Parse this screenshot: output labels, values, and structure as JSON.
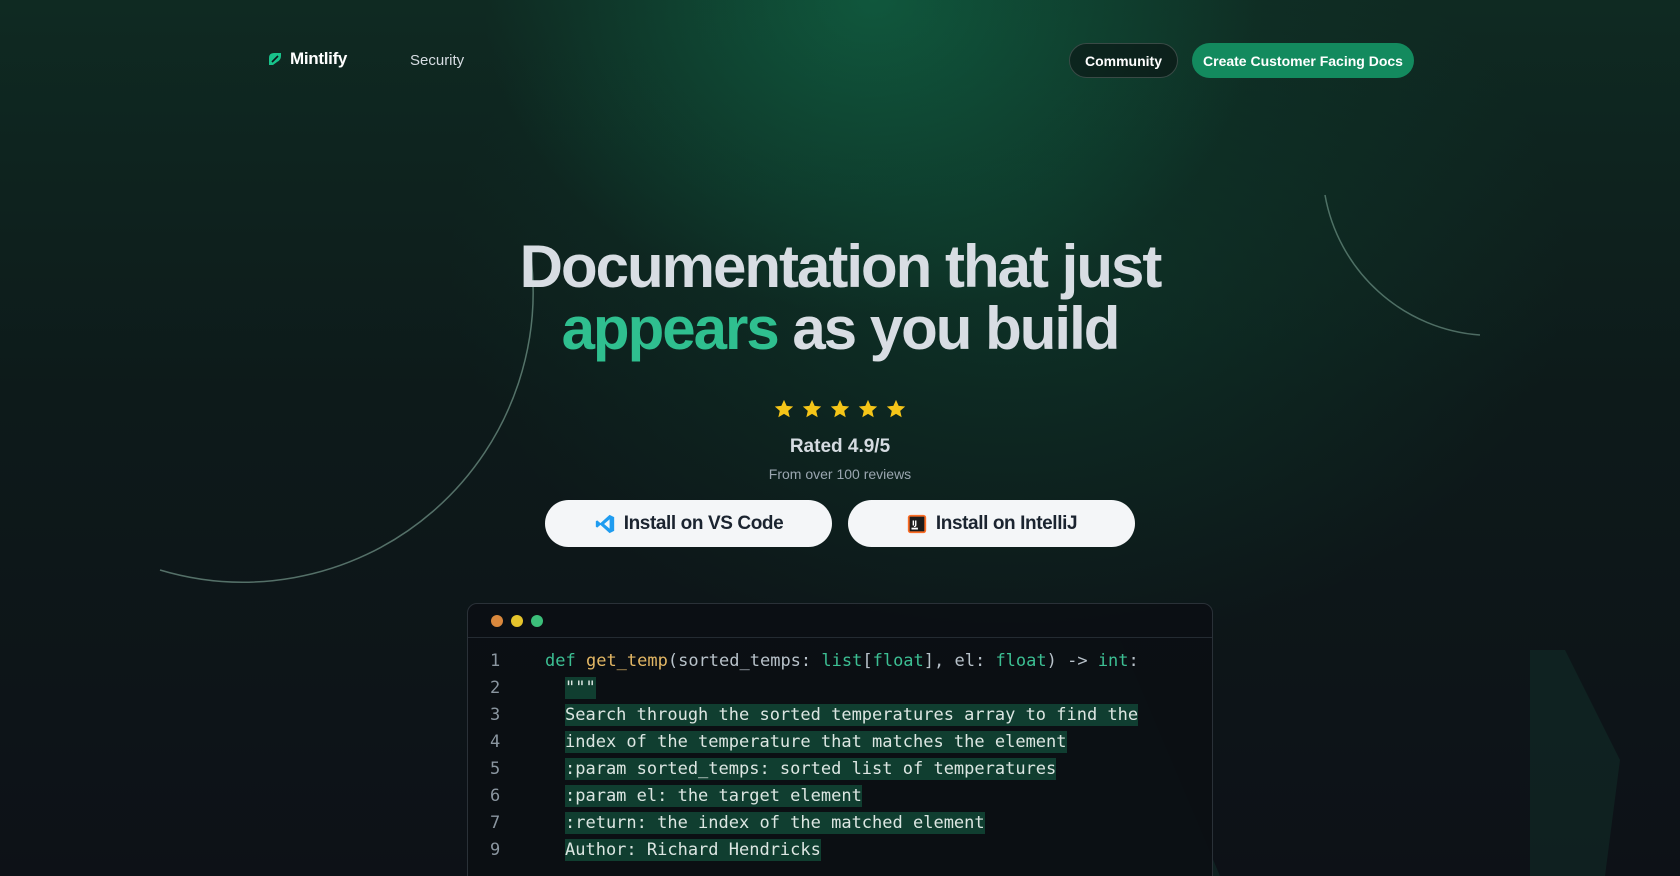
{
  "nav": {
    "brand": "Mintlify",
    "links": [
      "Security"
    ],
    "community_label": "Community",
    "cta_label": "Create Customer Facing Docs"
  },
  "hero": {
    "line1": "Documentation that just",
    "accent": "appears",
    "line2_rest": " as you build",
    "rating_stars": 5,
    "rated": "Rated 4.9/5",
    "reviews": "From over 100 reviews",
    "install_vscode": "Install on VS Code",
    "install_intellij": "Install on IntelliJ"
  },
  "code_window": {
    "dot_colors": [
      "#d9883d",
      "#e6c42c",
      "#3cbf7a"
    ],
    "signature": {
      "line": "1",
      "def": "def",
      "fn": "get_temp",
      "p1": "(sorted_temps: ",
      "t1": "list",
      "b1": "[",
      "t2": "float",
      "p2": "], el: ",
      "t3": "float",
      "p3": ") -> ",
      "t4": "int",
      "p4": ":"
    },
    "lines": [
      {
        "n": "2",
        "text": "\"\"\""
      },
      {
        "n": "3",
        "text": "Search through the sorted temperatures array to find the"
      },
      {
        "n": "4",
        "text": "index of the temperature that matches the element"
      },
      {
        "n": "5",
        "text": ":param sorted_temps: sorted list of temperatures"
      },
      {
        "n": "6",
        "text": ":param el: the target element"
      },
      {
        "n": "7",
        "text": ":return: the index of the matched element"
      },
      {
        "n": "9",
        "text": "Author: Richard Hendricks"
      }
    ]
  },
  "colors": {
    "accent": "#2fbf8f",
    "primary_button": "#138a5e",
    "star": "#f5c518"
  },
  "icons": [
    "mintlify-logo-icon",
    "star-icon",
    "vscode-icon",
    "intellij-icon"
  ]
}
